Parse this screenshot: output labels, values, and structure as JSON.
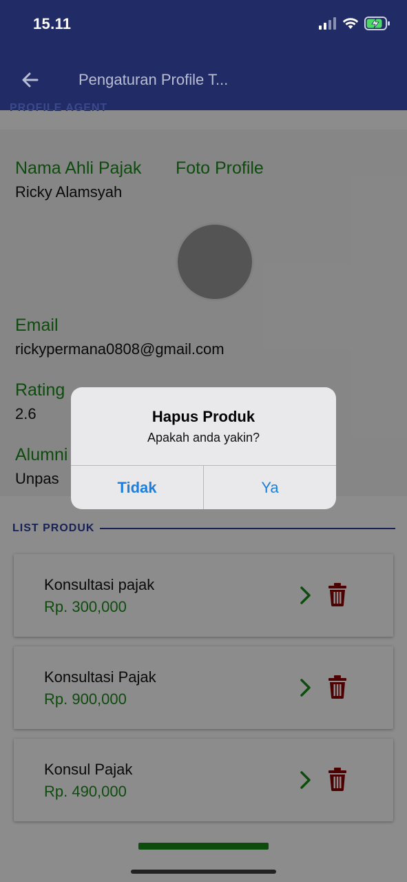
{
  "status": {
    "time": "15.11"
  },
  "appbar": {
    "title": "Pengaturan Profile T..."
  },
  "profile": {
    "section_label": "PROFILE AGENT",
    "name_label": "Nama Ahli Pajak",
    "name_value": "Ricky Alamsyah",
    "photo_label": "Foto Profile",
    "email_label": "Email",
    "email_value": "rickypermana0808@gmail.com",
    "rating_label": "Rating",
    "rating_value": "2.6",
    "alumni_label": "Alumni",
    "alumni_value": "Unpas"
  },
  "list": {
    "header": "LIST PRODUK",
    "items": [
      {
        "name": "Konsultasi pajak",
        "price": "Rp. 300,000"
      },
      {
        "name": "Konsultasi Pajak",
        "price": "Rp. 900,000"
      },
      {
        "name": "Konsul Pajak",
        "price": "Rp. 490,000"
      }
    ]
  },
  "dialog": {
    "title": "Hapus Produk",
    "message": "Apakah anda yakin?",
    "cancel_label": "Tidak",
    "confirm_label": "Ya"
  },
  "colors": {
    "appbar": "#212c66",
    "label_green": "#1a8a1a",
    "trash_red": "#8b0000",
    "dialog_button": "#1a7fe0"
  }
}
